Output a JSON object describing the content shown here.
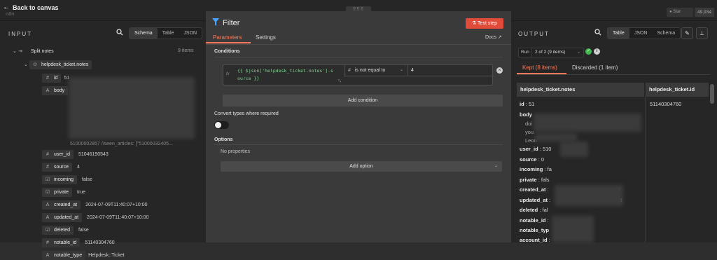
{
  "topbar": {
    "back_label": "Back to canvas",
    "logo_text": "n8n",
    "drag_glyph": "⠿⠿⠿",
    "github_star": "Star",
    "github_count": "49,934"
  },
  "input": {
    "title": "INPUT",
    "views": [
      "Schema",
      "Table",
      "JSON"
    ],
    "active_view": "Schema",
    "tree": {
      "root_label": "Split notes",
      "root_count": "9 items",
      "object_label": "helpdesk_ticket.notes",
      "fields": [
        {
          "type": "#",
          "key": "id",
          "value": "51"
        },
        {
          "type": "A",
          "key": "body",
          "value": ""
        },
        {
          "type": "",
          "key": "",
          "value": "51000002857 //seen_articles: [\"51000032405..."
        },
        {
          "type": "#",
          "key": "user_id",
          "value": "51046190543"
        },
        {
          "type": "#",
          "key": "source",
          "value": "4"
        },
        {
          "type": "☑",
          "key": "incoming",
          "value": "false"
        },
        {
          "type": "☑",
          "key": "private",
          "value": "true"
        },
        {
          "type": "A",
          "key": "created_at",
          "value": "2024-07-09T11:40:07+10:00"
        },
        {
          "type": "A",
          "key": "updated_at",
          "value": "2024-07-09T11:40:07+10:00"
        },
        {
          "type": "☑",
          "key": "deleted",
          "value": "false"
        },
        {
          "type": "#",
          "key": "notable_id",
          "value": "51140304760"
        },
        {
          "type": "A",
          "key": "notable_type",
          "value": "Helpdesk::Ticket"
        }
      ]
    }
  },
  "filter": {
    "title": "Filter",
    "test_step": "Test step",
    "tabs": {
      "parameters": "Parameters",
      "settings": "Settings"
    },
    "docs": "Docs",
    "conditions_label": "Conditions",
    "condition": {
      "fx": "fx",
      "expression_line1": "{{ $json['helpdesk_ticket.notes'].s",
      "expression_line2": "ource }}",
      "type_glyph": "#",
      "operator": "is not equal to",
      "value": "4"
    },
    "add_condition": "Add condition",
    "convert_types": "Convert types where required",
    "convert_enabled": false,
    "options_label": "Options",
    "no_properties": "No properties",
    "add_option": "Add option"
  },
  "output": {
    "title": "OUTPUT",
    "views": [
      "Table",
      "JSON",
      "Schema"
    ],
    "active_view": "Table",
    "run_label": "Run",
    "run_value": "2 of 2 (9 items)",
    "tabs": {
      "kept": "Kept (8 items)",
      "discarded": "Discarded (1 item)"
    },
    "columns": [
      "helpdesk_ticket.notes",
      "helpdesk_ticket.id"
    ],
    "rows": [
      {
        "key": "id",
        "value": "51"
      },
      {
        "key": "body",
        "value": ""
      },
      {
        "key": "",
        "value": "doi"
      },
      {
        "key": "",
        "value": "you"
      },
      {
        "key": "",
        "value": "Leon"
      },
      {
        "key": "user_id",
        "value": "510"
      },
      {
        "key": "source",
        "value": "0"
      },
      {
        "key": "incoming",
        "value": "fa"
      },
      {
        "key": "private",
        "value": "fals"
      },
      {
        "key": "created_at",
        "value": "0"
      },
      {
        "key": "updated_at",
        "value": "0"
      },
      {
        "key": "deleted",
        "value": "fal"
      },
      {
        "key": "notable_id",
        "value": ""
      },
      {
        "key": "notable_typ",
        "value": ""
      },
      {
        "key": "account_id",
        "value": ""
      }
    ],
    "ticket_id": "51140304760"
  },
  "colors": {
    "accent": "#ff7a5c",
    "test_button": "#e04b3a",
    "success": "#3fb950",
    "expression": "#7cd48e"
  }
}
